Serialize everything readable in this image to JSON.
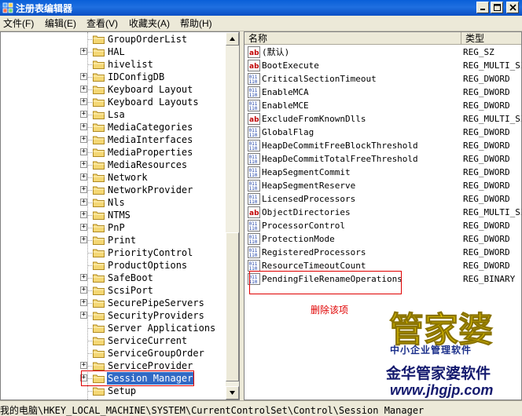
{
  "window": {
    "title": "注册表编辑器"
  },
  "menu": [
    "文件(F)",
    "编辑(E)",
    "查看(V)",
    "收藏夹(A)",
    "帮助(H)"
  ],
  "tree": [
    {
      "label": "GroupOrderList",
      "expand": false
    },
    {
      "label": "HAL",
      "expand": true
    },
    {
      "label": "hivelist",
      "expand": false
    },
    {
      "label": "IDConfigDB",
      "expand": true
    },
    {
      "label": "Keyboard Layout",
      "expand": true
    },
    {
      "label": "Keyboard Layouts",
      "expand": true
    },
    {
      "label": "Lsa",
      "expand": true
    },
    {
      "label": "MediaCategories",
      "expand": true
    },
    {
      "label": "MediaInterfaces",
      "expand": true
    },
    {
      "label": "MediaProperties",
      "expand": true
    },
    {
      "label": "MediaResources",
      "expand": true
    },
    {
      "label": "Network",
      "expand": true
    },
    {
      "label": "NetworkProvider",
      "expand": true
    },
    {
      "label": "Nls",
      "expand": true
    },
    {
      "label": "NTMS",
      "expand": true
    },
    {
      "label": "PnP",
      "expand": true
    },
    {
      "label": "Print",
      "expand": true
    },
    {
      "label": "PriorityControl",
      "expand": false
    },
    {
      "label": "ProductOptions",
      "expand": false
    },
    {
      "label": "SafeBoot",
      "expand": true
    },
    {
      "label": "ScsiPort",
      "expand": true
    },
    {
      "label": "SecurePipeServers",
      "expand": true
    },
    {
      "label": "SecurityProviders",
      "expand": true
    },
    {
      "label": "Server Applications",
      "expand": false
    },
    {
      "label": "ServiceCurrent",
      "expand": false
    },
    {
      "label": "ServiceGroupOrder",
      "expand": false
    },
    {
      "label": "ServiceProvider",
      "expand": true
    },
    {
      "label": "Session Manager",
      "expand": true,
      "selected": true
    },
    {
      "label": "Setup",
      "expand": false
    }
  ],
  "list_header": {
    "name": "名称",
    "type": "类型"
  },
  "values": [
    {
      "name": "(默认)",
      "type": "REG_SZ",
      "kind": "sz"
    },
    {
      "name": "BootExecute",
      "type": "REG_MULTI_SZ",
      "kind": "sz"
    },
    {
      "name": "CriticalSectionTimeout",
      "type": "REG_DWORD",
      "kind": "bin"
    },
    {
      "name": "EnableMCA",
      "type": "REG_DWORD",
      "kind": "bin"
    },
    {
      "name": "EnableMCE",
      "type": "REG_DWORD",
      "kind": "bin"
    },
    {
      "name": "ExcludeFromKnownDlls",
      "type": "REG_MULTI_SZ",
      "kind": "sz"
    },
    {
      "name": "GlobalFlag",
      "type": "REG_DWORD",
      "kind": "bin"
    },
    {
      "name": "HeapDeCommitFreeBlockThreshold",
      "type": "REG_DWORD",
      "kind": "bin"
    },
    {
      "name": "HeapDeCommitTotalFreeThreshold",
      "type": "REG_DWORD",
      "kind": "bin"
    },
    {
      "name": "HeapSegmentCommit",
      "type": "REG_DWORD",
      "kind": "bin"
    },
    {
      "name": "HeapSegmentReserve",
      "type": "REG_DWORD",
      "kind": "bin"
    },
    {
      "name": "LicensedProcessors",
      "type": "REG_DWORD",
      "kind": "bin"
    },
    {
      "name": "ObjectDirectories",
      "type": "REG_MULTI_SZ",
      "kind": "sz"
    },
    {
      "name": "ProcessorControl",
      "type": "REG_DWORD",
      "kind": "bin"
    },
    {
      "name": "ProtectionMode",
      "type": "REG_DWORD",
      "kind": "bin"
    },
    {
      "name": "RegisteredProcessors",
      "type": "REG_DWORD",
      "kind": "bin"
    },
    {
      "name": "ResourceTimeoutCount",
      "type": "REG_DWORD",
      "kind": "bin"
    },
    {
      "name": "PendingFileRenameOperations",
      "type": "REG_BINARY",
      "kind": "bin"
    }
  ],
  "annotation": "删除该项",
  "watermark": {
    "logo": "管家婆",
    "tagline": "中小企业管理软件",
    "brand": "金华管家婆软件",
    "url": "www.jhgjp.com"
  },
  "status": "我的电脑\\HKEY_LOCAL_MACHINE\\SYSTEM\\CurrentControlSet\\Control\\Session Manager",
  "colors": {
    "selection": "#316ac5",
    "annotation": "#e00000",
    "titlebar": "#0a5fd8"
  }
}
